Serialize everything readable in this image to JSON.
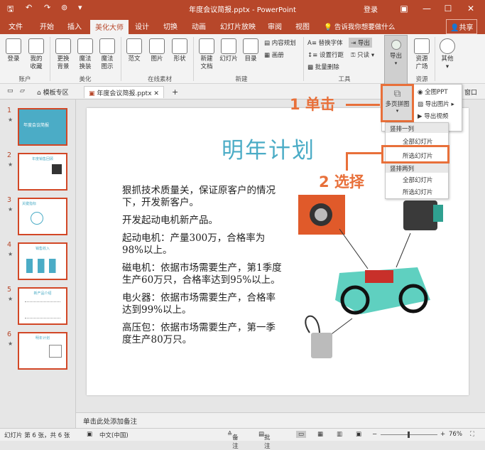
{
  "titlebar": {
    "doc_title": "年度会议简报.pptx - PowerPoint",
    "login": "登录",
    "colors": {
      "accent": "#b7472a",
      "callout": "#e8703a",
      "slide_title": "#4bacc6"
    }
  },
  "tabs": [
    "文件",
    "开始",
    "插入",
    "美化大师",
    "设计",
    "切换",
    "动画",
    "幻灯片放映",
    "审阅",
    "视图"
  ],
  "tell_me": "告诉我你想要做什么",
  "share": "共享",
  "ribbon": {
    "account": {
      "label": "账户",
      "buttons": [
        "登录",
        "我的\n收藏"
      ]
    },
    "beautify": {
      "label": "美化",
      "buttons": [
        "更换\n背景",
        "魔法\n换装",
        "魔法\n图示"
      ]
    },
    "online": {
      "label": "在线素材",
      "buttons": [
        "范文",
        "图片",
        "形状"
      ]
    },
    "create": {
      "label": "新建",
      "buttons": [
        "新建\n文档",
        "幻灯片",
        "目录"
      ],
      "small": [
        "内容规划",
        "画册"
      ]
    },
    "tools": {
      "label": "工具",
      "small": [
        "替换字体",
        "导出",
        "设置行距",
        "只读",
        "批量删除"
      ]
    },
    "export": {
      "label": "导出"
    },
    "resources": {
      "label": "资源",
      "button": "资源\n广场"
    },
    "other": {
      "button": "其他"
    }
  },
  "doctabs": {
    "template": "模板专区",
    "file": "年度会议简报.pptx"
  },
  "thumbnails": [
    {
      "num": "1",
      "title": "年度会议简报"
    },
    {
      "num": "2",
      "title": "年度销售回顾"
    },
    {
      "num": "3",
      "title": "关键指标"
    },
    {
      "num": "4",
      "title": "销售收入"
    },
    {
      "num": "5",
      "title": "新产品介绍"
    },
    {
      "num": "6",
      "title": "明年计划"
    }
  ],
  "slide": {
    "title": "明年计划",
    "paragraphs": [
      "狠抓技术质量关，保证原客户的情况下，开发新客户。",
      "开发起动电机新产品。",
      "起动电机：产量300万，合格率为98%以上。",
      "磁电机：依据市场需要生产，第1季度生产60万只，合格率达到95%以上。",
      "电火器：依据市场需要生产，合格率达到99%以上。",
      "高压包：依据市场需要生产，第一季度生产80万只。"
    ]
  },
  "export_menu": {
    "button": "多页拼图",
    "items": [
      "全图PPT",
      "导出图片",
      "导出视频"
    ],
    "section1": "竖排一列",
    "all1": "全部幻灯片",
    "selected1": "所选幻灯片",
    "section2": "竖排两列",
    "all2": "全部幻灯片",
    "selected2": "所选幻灯片",
    "cut": "窗口"
  },
  "callouts": {
    "step1": "1 单击",
    "step2": "2 选择"
  },
  "notes": "单击此处添加备注",
  "status": {
    "slide_info": "幻灯片 第 6 张，共 6 张",
    "lang": "中文(中国)",
    "notes_btn": "备注",
    "comments_btn": "批注",
    "zoom": "76%"
  }
}
